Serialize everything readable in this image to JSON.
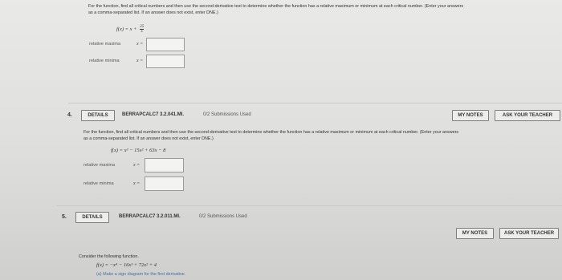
{
  "q3": {
    "instructions_1": "For the function, find all critical numbers and then use the second-derivative test to determine whether the function has a relative maximum or minimum at each critical number. (Enter your answers",
    "instructions_2": "as a comma-separated list. If an answer does not exist, enter DNE.)",
    "function": "f(x) = x +",
    "fraction_num": "25",
    "fraction_den": "x",
    "rel_max_label": "relative maxima",
    "rel_min_label": "relative minima",
    "answer_prefix": "x ="
  },
  "q4": {
    "number": "4.",
    "details_label": "DETAILS",
    "course": "BERRAPCALC7 3.2.041.MI.",
    "submissions": "0/2 Submissions Used",
    "my_notes": "MY NOTES",
    "ask_teacher": "ASK YOUR TEACHER",
    "instructions_1": "For the function, find all critical numbers and then use the second-derivative test to determine whether the function has a relative maximum or minimum at each critical number. (Enter your answers",
    "instructions_2": "as a comma-separated list. If an answer does not exist, enter DNE.)",
    "function": "f(x) = x³ − 15x² + 63x − 8",
    "rel_max_label": "relative maxima",
    "rel_min_label": "relative minima",
    "answer_prefix": "x ="
  },
  "q5": {
    "number": "5.",
    "details_label": "DETAILS",
    "course": "BERRAPCALC7 3.2.011.MI.",
    "submissions": "0/2 Submissions Used",
    "my_notes": "MY NOTES",
    "ask_teacher": "ASK YOUR TEACHER",
    "consider": "Consider the following function.",
    "function": "f(x) = −x⁴ − 16x³ + 72x² + 4",
    "part_a": "(a) Make a sign diagram for the first derivative."
  }
}
